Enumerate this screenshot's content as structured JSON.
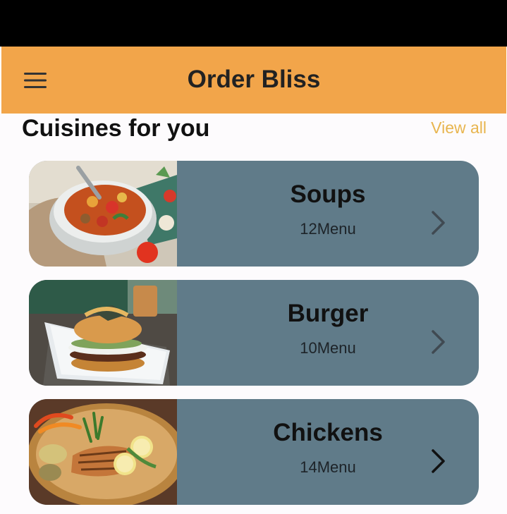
{
  "app_bar": {
    "title": "Order Bliss",
    "menu_icon": "hamburger-menu-icon",
    "color": "#f2a54a"
  },
  "section": {
    "title": "Cuisines for you",
    "view_all_label": "View all",
    "view_all_color": "#e8b54f"
  },
  "cuisines": [
    {
      "name": "Soups",
      "count": "12Menu",
      "image": "soup-bowl-image",
      "chevron_color": "#404a52"
    },
    {
      "name": "Burger",
      "count": "10Menu",
      "image": "burger-plate-image",
      "chevron_color": "#404a52"
    },
    {
      "name": "Chickens",
      "count": "14Menu",
      "image": "grilled-chicken-image",
      "chevron_color": "#111111"
    }
  ],
  "card_color": "#607b89"
}
